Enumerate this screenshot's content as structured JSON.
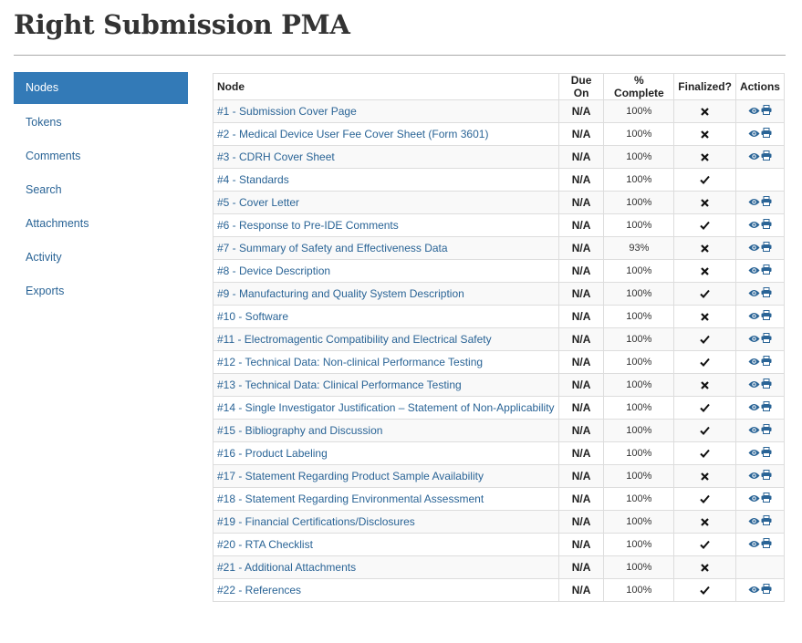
{
  "page": {
    "title": "Right Submission PMA"
  },
  "sidebar": {
    "items": [
      {
        "label": "Nodes",
        "active": true
      },
      {
        "label": "Tokens"
      },
      {
        "label": "Comments"
      },
      {
        "label": "Search"
      },
      {
        "label": "Attachments"
      },
      {
        "label": "Activity"
      },
      {
        "label": "Exports"
      }
    ]
  },
  "table": {
    "headers": {
      "node": "Node",
      "due": "Due On",
      "pct": "% Complete",
      "fin": "Finalized?",
      "actions": "Actions"
    },
    "rows": [
      {
        "node": "#1 - Submission Cover Page",
        "due": "N/A",
        "pct": "100%",
        "finalized": false,
        "actions": true
      },
      {
        "node": "#2 - Medical Device User Fee Cover Sheet (Form 3601)",
        "due": "N/A",
        "pct": "100%",
        "finalized": false,
        "actions": true
      },
      {
        "node": "#3 - CDRH Cover Sheet",
        "due": "N/A",
        "pct": "100%",
        "finalized": false,
        "actions": true
      },
      {
        "node": "#4 - Standards",
        "due": "N/A",
        "pct": "100%",
        "finalized": true,
        "actions": false
      },
      {
        "node": "#5 - Cover Letter",
        "due": "N/A",
        "pct": "100%",
        "finalized": false,
        "actions": true
      },
      {
        "node": "#6 - Response to Pre-IDE Comments",
        "due": "N/A",
        "pct": "100%",
        "finalized": true,
        "actions": true
      },
      {
        "node": "#7 - Summary of Safety and Effectiveness Data",
        "due": "N/A",
        "pct": "93%",
        "finalized": false,
        "actions": true
      },
      {
        "node": "#8 - Device Description",
        "due": "N/A",
        "pct": "100%",
        "finalized": false,
        "actions": true
      },
      {
        "node": "#9 - Manufacturing and Quality System Description",
        "due": "N/A",
        "pct": "100%",
        "finalized": true,
        "actions": true
      },
      {
        "node": "#10 - Software",
        "due": "N/A",
        "pct": "100%",
        "finalized": false,
        "actions": true
      },
      {
        "node": "#11 - Electromagentic Compatibility and Electrical Safety",
        "due": "N/A",
        "pct": "100%",
        "finalized": true,
        "actions": true
      },
      {
        "node": "#12 - Technical Data: Non-clinical Performance Testing",
        "due": "N/A",
        "pct": "100%",
        "finalized": true,
        "actions": true
      },
      {
        "node": "#13 - Technical Data: Clinical Performance Testing",
        "due": "N/A",
        "pct": "100%",
        "finalized": false,
        "actions": true
      },
      {
        "node": "#14 - Single Investigator Justification – Statement of Non-Applicability",
        "due": "N/A",
        "pct": "100%",
        "finalized": true,
        "actions": true
      },
      {
        "node": "#15 - Bibliography and Discussion",
        "due": "N/A",
        "pct": "100%",
        "finalized": true,
        "actions": true
      },
      {
        "node": "#16 - Product Labeling",
        "due": "N/A",
        "pct": "100%",
        "finalized": true,
        "actions": true
      },
      {
        "node": "#17 - Statement Regarding Product Sample Availability",
        "due": "N/A",
        "pct": "100%",
        "finalized": false,
        "actions": true
      },
      {
        "node": "#18 - Statement Regarding Environmental Assessment",
        "due": "N/A",
        "pct": "100%",
        "finalized": true,
        "actions": true
      },
      {
        "node": "#19 - Financial Certifications/Disclosures",
        "due": "N/A",
        "pct": "100%",
        "finalized": false,
        "actions": true
      },
      {
        "node": "#20 - RTA Checklist",
        "due": "N/A",
        "pct": "100%",
        "finalized": true,
        "actions": true
      },
      {
        "node": "#21 - Additional Attachments",
        "due": "N/A",
        "pct": "100%",
        "finalized": false,
        "actions": false
      },
      {
        "node": "#22 - References",
        "due": "N/A",
        "pct": "100%",
        "finalized": true,
        "actions": true
      }
    ]
  },
  "icons": {
    "finalized_yes": "check-icon",
    "finalized_no": "cross-icon",
    "view": "eye-icon",
    "print": "print-icon"
  },
  "colors": {
    "accent": "#337ab7",
    "link": "#2a6496"
  }
}
